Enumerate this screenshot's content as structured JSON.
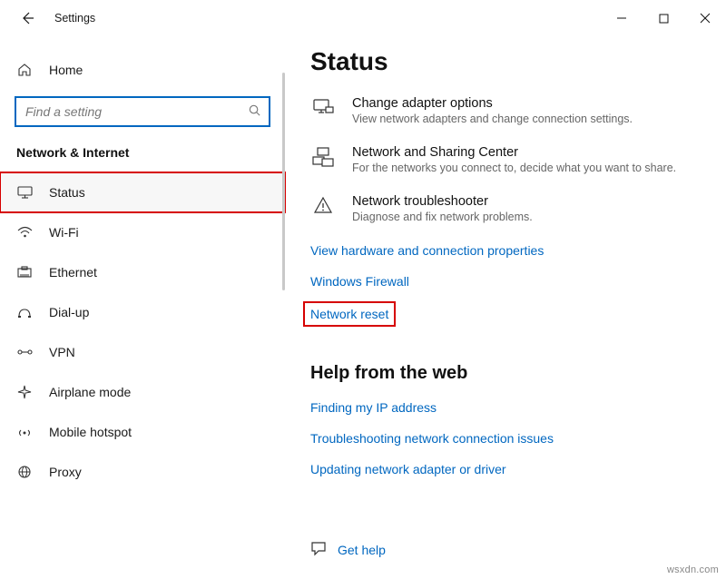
{
  "titlebar": {
    "title": "Settings"
  },
  "sidebar": {
    "home": "Home",
    "search_placeholder": "Find a setting",
    "section": "Network & Internet",
    "items": [
      {
        "label": "Status"
      },
      {
        "label": "Wi-Fi"
      },
      {
        "label": "Ethernet"
      },
      {
        "label": "Dial-up"
      },
      {
        "label": "VPN"
      },
      {
        "label": "Airplane mode"
      },
      {
        "label": "Mobile hotspot"
      },
      {
        "label": "Proxy"
      }
    ]
  },
  "content": {
    "heading": "Status",
    "options": [
      {
        "title": "Change adapter options",
        "desc": "View network adapters and change connection settings."
      },
      {
        "title": "Network and Sharing Center",
        "desc": "For the networks you connect to, decide what you want to share."
      },
      {
        "title": "Network troubleshooter",
        "desc": "Diagnose and fix network problems."
      }
    ],
    "links": [
      "View hardware and connection properties",
      "Windows Firewall",
      "Network reset"
    ],
    "help_heading": "Help from the web",
    "help_links": [
      "Finding my IP address",
      "Troubleshooting network connection issues",
      "Updating network adapter or driver"
    ],
    "get_help": "Get help"
  },
  "watermark": "wsxdn.com"
}
